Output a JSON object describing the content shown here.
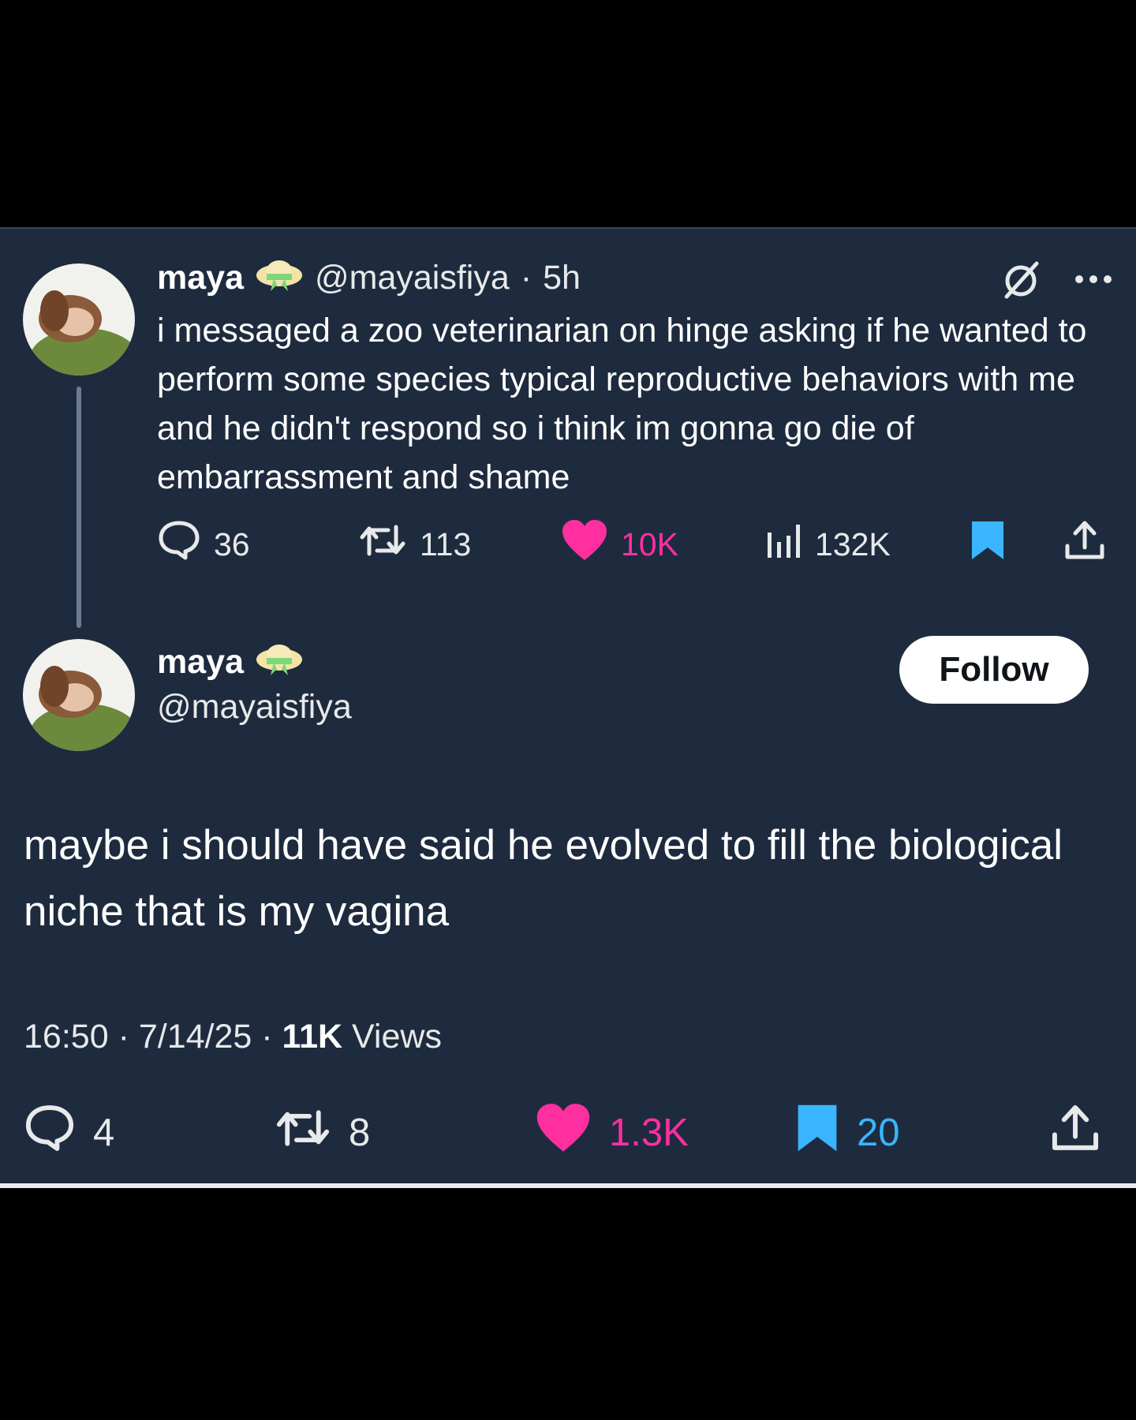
{
  "tweet1": {
    "name": "maya",
    "handle": "@mayaisfiya",
    "separator": "·",
    "time": "5h",
    "text": "i messaged a zoo veterinarian on hinge asking if he wanted to perform some species typical reproductive behaviors with me and he didn't respond so i think im gonna go die of embarrassment and shame",
    "stats": {
      "replies": "36",
      "reposts": "113",
      "likes": "10K",
      "views": "132K"
    }
  },
  "tweet2": {
    "name": "maya",
    "handle": "@mayaisfiya",
    "follow_label": "Follow",
    "text": "maybe i should have said he evolved to fill the biological niche that is my vagina",
    "time": "16:50",
    "date": "7/14/25",
    "views_count": "11K",
    "views_label": "Views",
    "separator": "·",
    "stats": {
      "replies": "4",
      "reposts": "8",
      "likes": "1.3K",
      "bookmarks": "20"
    }
  },
  "icons": {
    "reply": "speech-bubble-icon",
    "repost": "repost-arrows-icon",
    "like": "heart-icon",
    "views": "bar-chart-icon",
    "bookmark": "bookmark-icon",
    "share": "share-upload-icon",
    "grok": "grok-icon",
    "more": "more-dots-icon",
    "hat": "cottage-hat-emoji"
  },
  "colors": {
    "background": "#1e2b3e",
    "like": "#ff2fa0",
    "bookmark": "#3ab5ff",
    "text": "#e7e9ea",
    "follow_button": "#ffffff"
  }
}
